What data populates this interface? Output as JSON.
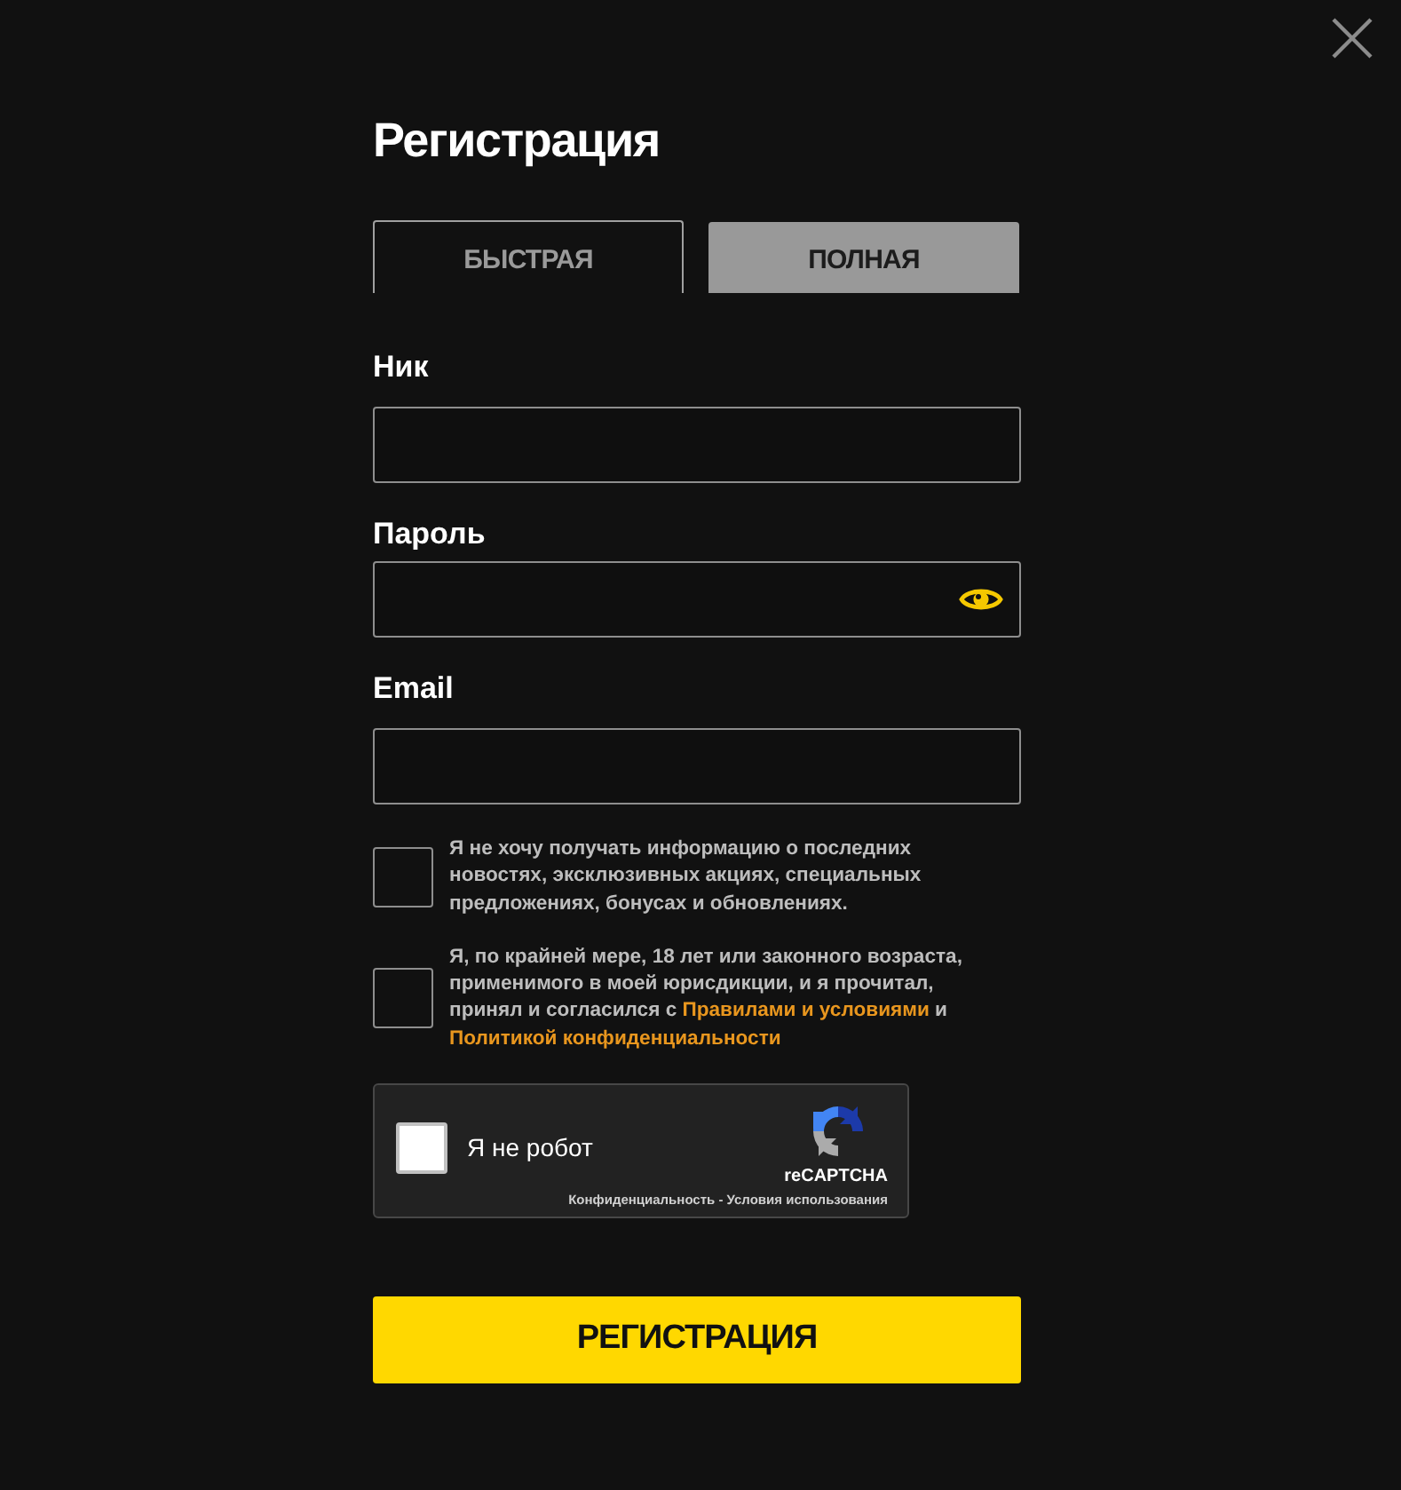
{
  "title": "Регистрация",
  "tabs": [
    {
      "label": "БЫСТРАЯ",
      "selected": true
    },
    {
      "label": "ПОЛНАЯ",
      "selected": false
    }
  ],
  "fields": [
    {
      "label": "Ник",
      "kind": "text"
    },
    {
      "label": "Пароль",
      "kind": "password"
    },
    {
      "label": "Email",
      "kind": "text"
    }
  ],
  "consents": [
    {
      "checked": false,
      "parts": [
        {
          "kind": "text",
          "text": "Я не хочу получать информацию о последних новостях, эксклюзивных акциях, специальных предложениях, бонусах и обновлениях."
        }
      ]
    },
    {
      "checked": false,
      "parts": [
        {
          "kind": "text",
          "text": "Я, по крайней мере, 18 лет или законного возраста, применимого в моей юрисдикции, и я прочитал, принял и согласился с "
        },
        {
          "kind": "link",
          "text": "Правилами и условиями"
        },
        {
          "kind": "text",
          "text": " и "
        },
        {
          "kind": "link",
          "text": "Политикой конфиденциальности"
        }
      ]
    }
  ],
  "captcha": {
    "label": "Я не робот",
    "checked": false,
    "brand": "reCAPTCHA",
    "footer": "Конфиденциальность - Условия использования"
  },
  "submit": "РЕГИСТРАЦИЯ"
}
